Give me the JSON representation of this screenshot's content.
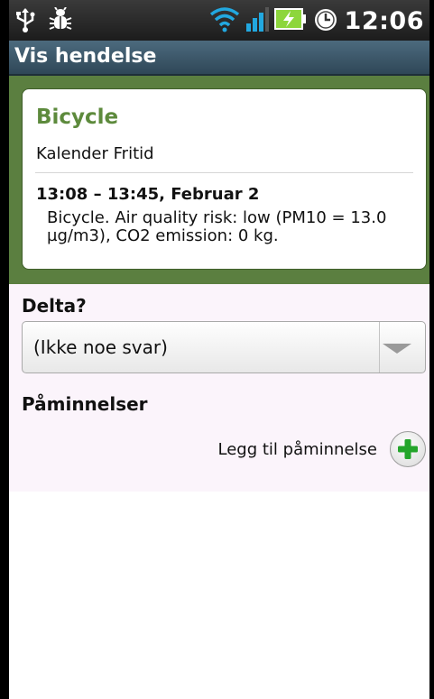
{
  "status_bar": {
    "time": "12:06",
    "icons": [
      "usb-icon",
      "debug-bug-icon",
      "wifi-icon",
      "signal-bars-icon",
      "battery-charging-icon",
      "alarm-clock-icon"
    ]
  },
  "title_bar": {
    "title": "Vis hendelse"
  },
  "event": {
    "title": "Bicycle",
    "calendar": "Kalender  Fritid",
    "when": "13:08 – 13:45, Februar 2",
    "description": "Bicycle.  Air quality risk: low (PM10 = 13.0 µg/m3), CO2 emission: 0 kg."
  },
  "attendance": {
    "label": "Delta?",
    "selected": "(Ikke noe svar)"
  },
  "reminders": {
    "label": "Påminnelser",
    "add_label": "Legg til påminnelse"
  },
  "colors": {
    "event_green": "#5b7f40",
    "title_green": "#5d8a3c",
    "titlebar_blue": "#3d5869",
    "add_plus_green": "#23a52a"
  }
}
